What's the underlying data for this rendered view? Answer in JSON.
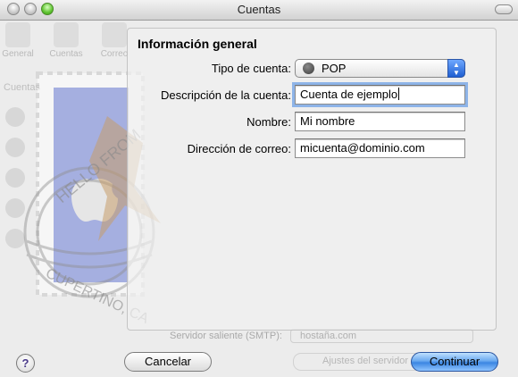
{
  "window": {
    "title": "Cuentas"
  },
  "background_toolbar": {
    "items": [
      "General",
      "Cuentas",
      "Correo"
    ]
  },
  "background_list": {
    "heading": "Cuentas"
  },
  "background_smtp": {
    "label": "Servidor saliente (SMTP):",
    "value": "hostaña.com",
    "button": "Ajustes del servidor"
  },
  "panel": {
    "title": "Información general",
    "account_type": {
      "label": "Tipo de cuenta:",
      "value": "POP"
    },
    "description": {
      "label": "Descripción de la cuenta:",
      "value": "Cuenta de ejemplo"
    },
    "name": {
      "label": "Nombre:",
      "value": "Mi nombre"
    },
    "email": {
      "label": "Dirección de correo:",
      "value": "micuenta@dominio.com"
    }
  },
  "buttons": {
    "help": "?",
    "cancel": "Cancelar",
    "continue": "Continuar"
  },
  "stamp": {
    "postmark_top": "HELLO FROM",
    "postmark_bottom": "CUPERTINO, CA"
  },
  "colors": {
    "primary_button": "#3b86e2",
    "stamp_blue": "#6c7ed8"
  }
}
